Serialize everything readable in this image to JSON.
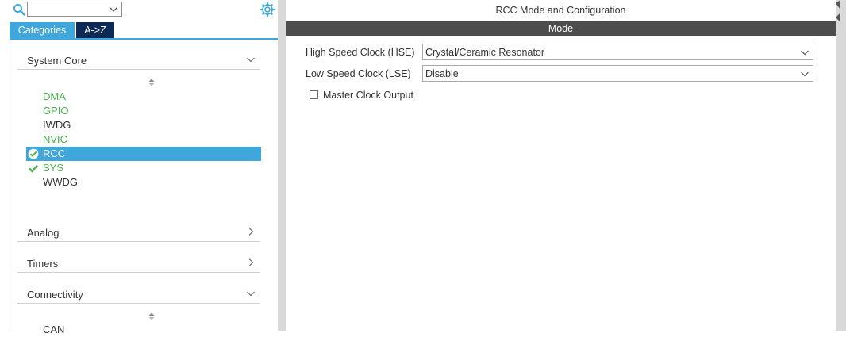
{
  "left_panel": {
    "search_value": "",
    "tabs": [
      {
        "label": "Categories"
      },
      {
        "label": "A->Z"
      }
    ],
    "sections": [
      {
        "label": "System Core",
        "expanded": true
      },
      {
        "label": "Analog",
        "expanded": false
      },
      {
        "label": "Timers",
        "expanded": false
      },
      {
        "label": "Connectivity",
        "expanded": true
      }
    ],
    "system_core_items": [
      {
        "label": "DMA",
        "status": "green"
      },
      {
        "label": "GPIO",
        "status": "green"
      },
      {
        "label": "IWDG",
        "status": "plain"
      },
      {
        "label": "NVIC",
        "status": "green"
      },
      {
        "label": "RCC",
        "status": "selected-check"
      },
      {
        "label": "SYS",
        "status": "check"
      },
      {
        "label": "WWDG",
        "status": "plain"
      }
    ],
    "connectivity_items": [
      {
        "label": "CAN"
      }
    ]
  },
  "right_panel": {
    "title": "RCC Mode and Configuration",
    "mode_header": "Mode",
    "hse_label": "High Speed Clock (HSE)",
    "hse_value": "Crystal/Ceramic Resonator",
    "lse_label": "Low Speed Clock (LSE)",
    "lse_value": "Disable",
    "mco_label": "Master Clock Output",
    "mco_checked": false
  },
  "colors": {
    "accent": "#3fa7dc",
    "tab_dark": "#0d2a57",
    "ok_green": "#4caf50",
    "mode_bar": "#4d4d4d"
  },
  "icons": [
    "search-icon",
    "gear-icon",
    "chevron-down-icon",
    "chevron-right-icon",
    "sort-icon",
    "check-icon",
    "check-circle-icon"
  ]
}
